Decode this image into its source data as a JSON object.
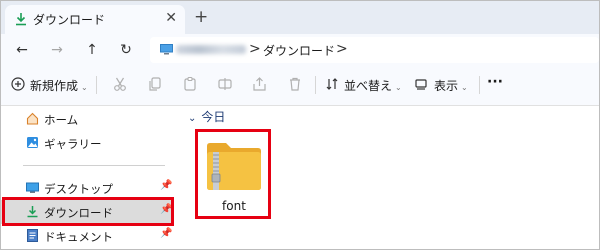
{
  "window": {
    "tab_title": "ダウンロード",
    "tab_close": "✕",
    "new_tab": "+"
  },
  "nav": {
    "back": "←",
    "forward": "→",
    "up": "↑",
    "refresh": "↻",
    "separator": ">",
    "breadcrumb_current": "ダウンロード",
    "breadcrumb_trailing": ">"
  },
  "toolbar": {
    "new_label": "新規作成",
    "sort_label": "並べ替え",
    "view_label": "表示",
    "more_label": "···",
    "caret": "⌄"
  },
  "sidebar": {
    "items": [
      {
        "label": "ホーム",
        "icon": "home-icon"
      },
      {
        "label": "ギャラリー",
        "icon": "gallery-icon"
      },
      {
        "label": "デスクトップ",
        "icon": "desktop-icon",
        "pinned": true
      },
      {
        "label": "ダウンロード",
        "icon": "download-icon",
        "pinned": true,
        "selected": true
      },
      {
        "label": "ドキュメント",
        "icon": "documents-icon",
        "pinned": true
      }
    ],
    "pin_glyph": "📌"
  },
  "main": {
    "group_label": "今日",
    "group_chevron": "⌄",
    "files": [
      {
        "name": "font",
        "icon": "zip-folder-icon",
        "highlighted": true
      }
    ]
  },
  "colors": {
    "highlight_border": "#e60012",
    "accent_blue": "#1d3a73",
    "folder_yellow": "#f5c242",
    "download_green": "#1a9e55"
  }
}
